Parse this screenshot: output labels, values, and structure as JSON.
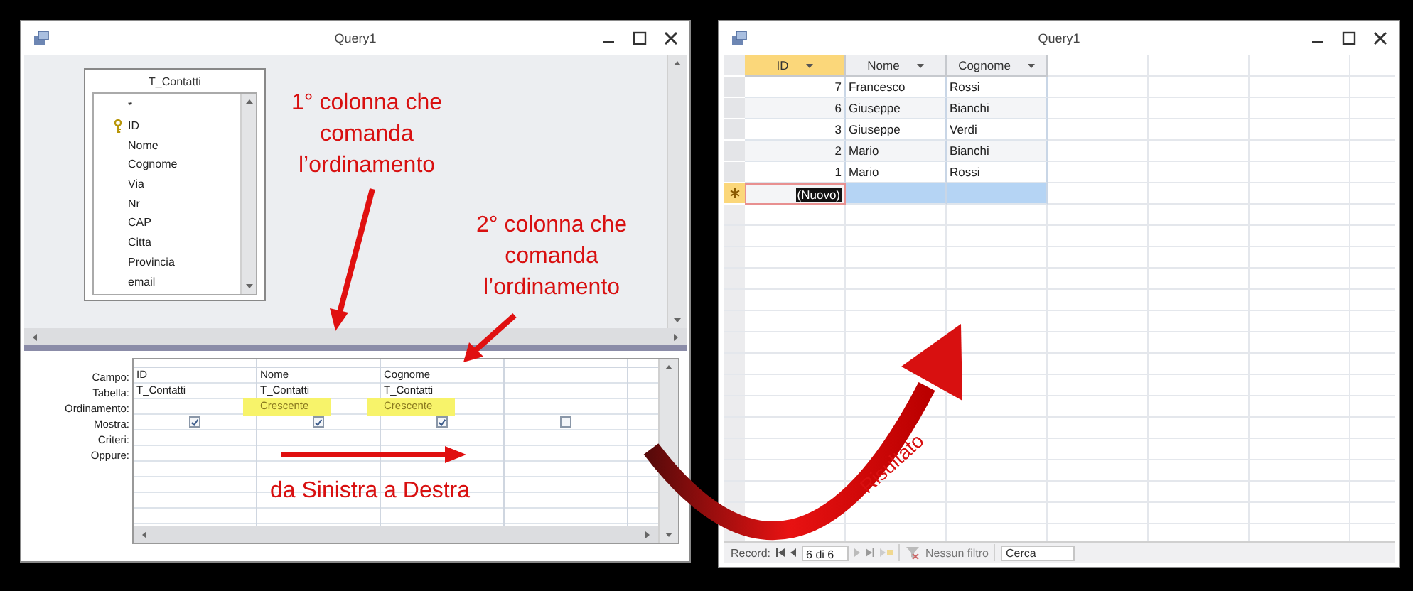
{
  "design_window": {
    "title": "Query1",
    "table": {
      "title": "T_Contatti",
      "fields": [
        {
          "name": "*",
          "key": false
        },
        {
          "name": "ID",
          "key": true
        },
        {
          "name": "Nome",
          "key": false
        },
        {
          "name": "Cognome",
          "key": false
        },
        {
          "name": "Via",
          "key": false
        },
        {
          "name": "Nr",
          "key": false
        },
        {
          "name": "CAP",
          "key": false
        },
        {
          "name": "Citta",
          "key": false
        },
        {
          "name": "Provincia",
          "key": false
        },
        {
          "name": "email",
          "key": false
        }
      ]
    },
    "grid": {
      "row_labels": [
        "Campo:",
        "Tabella:",
        "Ordinamento:",
        "Mostra:",
        "Criteri:",
        "Oppure:"
      ],
      "columns": [
        {
          "campo": "ID",
          "tabella": "T_Contatti",
          "mostra": true
        },
        {
          "campo": "Nome",
          "tabella": "T_Contatti",
          "ordinamento": "Crescente",
          "highlighted": true,
          "mostra": true
        },
        {
          "campo": "Cognome",
          "tabella": "T_Contatti",
          "ordinamento": "Crescente",
          "highlighted": true,
          "mostra": true
        },
        {
          "mostra": false
        }
      ]
    }
  },
  "result_window": {
    "title": "Query1",
    "columns": [
      {
        "label": "ID",
        "selected": true
      },
      {
        "label": "Nome",
        "selected": false
      },
      {
        "label": "Cognome",
        "selected": false
      }
    ],
    "rows": [
      [
        "7",
        "Francesco",
        "Rossi"
      ],
      [
        "6",
        "Giuseppe",
        "Bianchi"
      ],
      [
        "3",
        "Giuseppe",
        "Verdi"
      ],
      [
        "2",
        "Mario",
        "Bianchi"
      ],
      [
        "1",
        "Mario",
        "Rossi"
      ]
    ],
    "new_row": "(Nuovo)",
    "navigation": {
      "label": "Record:",
      "position": "6 di 6",
      "filter": "Nessun filtro",
      "search_placeholder": "Cerca"
    }
  },
  "annotations": [
    {
      "kind": "note",
      "lines": [
        "1° colonna che",
        "comanda",
        "l’ordinamento"
      ]
    },
    {
      "kind": "note",
      "lines": [
        "2° colonna che",
        "comanda",
        "l’ordinamento"
      ]
    },
    {
      "kind": "note",
      "lines": [
        "da Sinistra a Destra"
      ]
    },
    {
      "kind": "curved",
      "lines": [
        "Risultato"
      ]
    }
  ]
}
